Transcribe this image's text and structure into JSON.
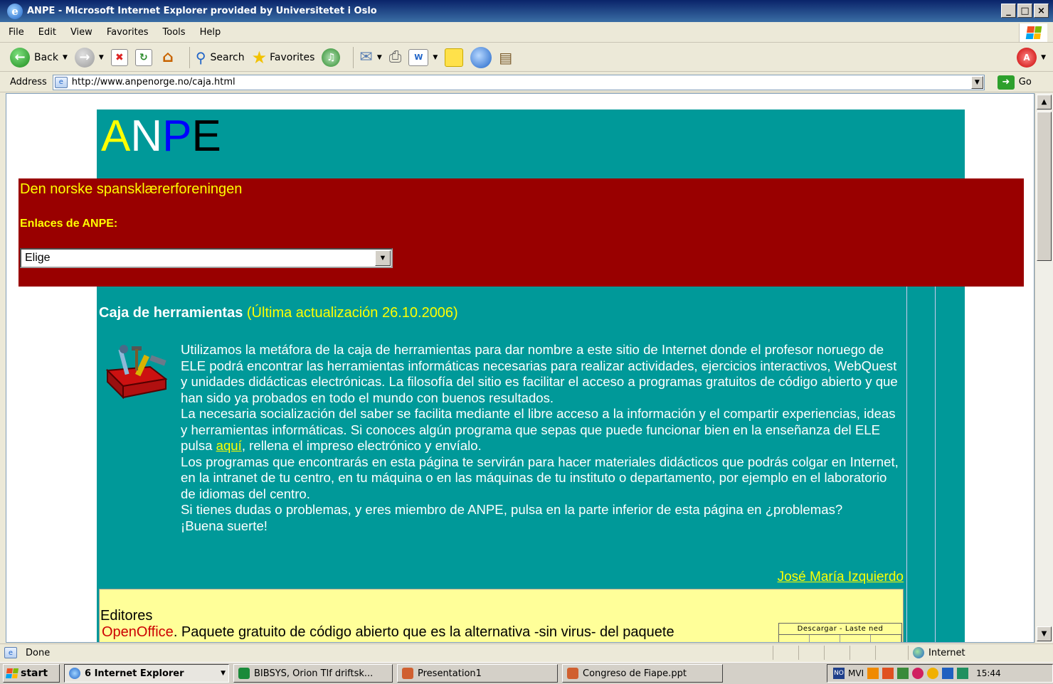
{
  "window": {
    "title": "ANPE - Microsoft Internet Explorer provided by Universitetet i Oslo",
    "buttons": [
      "_",
      "□",
      "×"
    ]
  },
  "menu": [
    "File",
    "Edit",
    "View",
    "Favorites",
    "Tools",
    "Help"
  ],
  "toolbar": {
    "back_label": "Back",
    "search_label": "Search",
    "favorites_label": "Favorites"
  },
  "address": {
    "label": "Address",
    "url": "http://www.anpenorge.no/caja.html",
    "go_label": "Go"
  },
  "page": {
    "logo_letters": [
      {
        "char": "A",
        "color": "#ffff00"
      },
      {
        "char": "N",
        "color": "#ffffff"
      },
      {
        "char": "P",
        "color": "#0000ff"
      },
      {
        "char": "E",
        "color": "#000000"
      }
    ],
    "subtitle": "Den norske spansklærerforeningen",
    "enlaces_label": "Enlaces de ANPE:",
    "enlaces_selected": "Elige",
    "section_title": "Caja de herramientas",
    "section_updated": "(Última actualización 26.10.2006)",
    "intro_p1": "Utilizamos la metáfora de la caja de herramientas para dar nombre a este sitio de Internet donde el profesor noruego de ELE podrá encontrar las herramientas informáticas necesarias para realizar actividades, ejercicios interactivos, WebQuest y unidades didácticas electrónicas. La filosofía del sitio es facilitar el acceso a programas gratuitos de código abierto y que han sido ya probados en todo el mundo con buenos resultados.",
    "intro_p2a": "La necesaria socialización del saber se facilita mediante el libre acceso a la información y el compartir experiencias, ideas y herramientas informáticas. Si conoces algún programa que sepas que puede funcionar bien en la enseñanza del ELE pulsa ",
    "intro_link": "aquí",
    "intro_p2b": ", rellena el impreso electrónico y envíalo.",
    "intro_p3": "Los programas que encontrarás en esta página te servirán para hacer materiales didácticos que podrás colgar en Internet, en la intranet de tu centro, en tu máquina o en las máquinas de tu instituto o departamento, por ejemplo en el laboratorio de idiomas del centro.",
    "intro_p4": "Si tienes dudas o problemas, y eres miembro de ANPE, pulsa en la parte inferior de esta página en ¿problemas?",
    "intro_p5": "¡Buena suerte!",
    "author": "José María Izquierdo",
    "editores_title": "Editores",
    "openoffice_name": "OpenOffice",
    "openoffice_desc": ". Paquete gratuito de código abierto que es la alternativa -sin virus- del paquete",
    "download_header": "Descargar - Laste ned"
  },
  "status": {
    "text": "Done",
    "zone": "Internet"
  },
  "taskbar": {
    "start": "start",
    "tasks": [
      {
        "label": "6 Internet Explorer",
        "active": true
      },
      {
        "label": "BIBSYS, Orion Tlf driftsk...",
        "active": false
      },
      {
        "label": "Presentation1",
        "active": false
      },
      {
        "label": "Congreso de Fiape.ppt",
        "active": false
      }
    ],
    "tray_lang": "MVI",
    "clock": "15:44"
  }
}
